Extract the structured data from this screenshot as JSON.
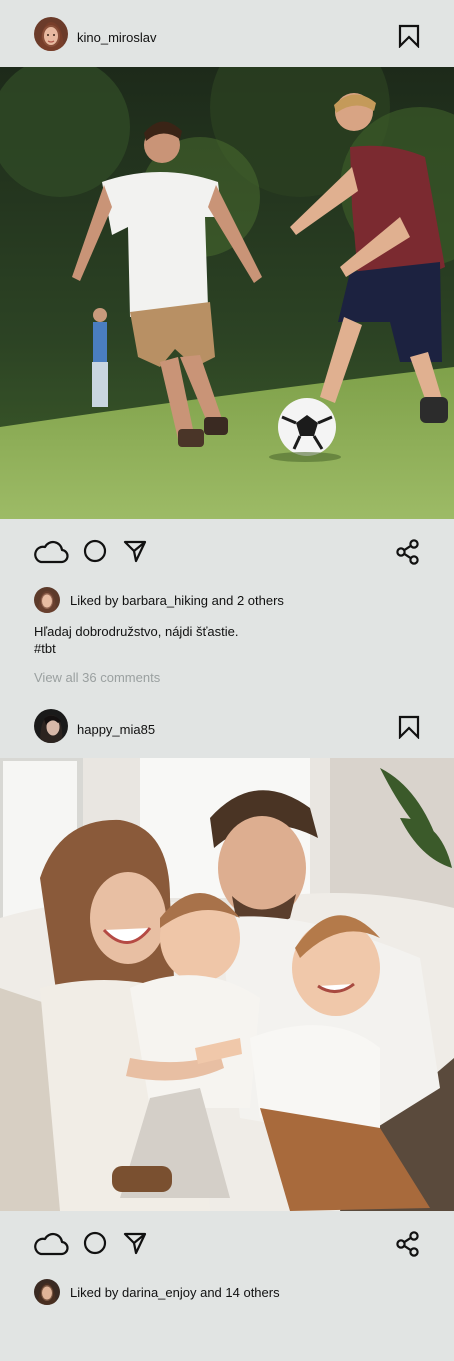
{
  "posts": [
    {
      "username": "kino_miroslav",
      "likes_text": "Liked by barbara_hiking and 2 others",
      "caption_line1": "Hľadaj dobrodružstvo, nájdi šťastie.",
      "caption_line2": "#tbt",
      "comments_link": "View all 36 comments",
      "photo_subject": "boys playing soccer on grass"
    },
    {
      "username": "happy_mia85",
      "likes_text": "Liked by darina_enjoy and 14 others",
      "photo_subject": "family with two toddlers on sofa"
    }
  ],
  "icons": [
    "bookmark-icon",
    "like-cloud-icon",
    "comment-circle-icon",
    "send-arrow-icon",
    "share-icon"
  ],
  "colors": {
    "background": "#e1e4e3",
    "text": "#111111",
    "muted": "#9aa0a0"
  }
}
